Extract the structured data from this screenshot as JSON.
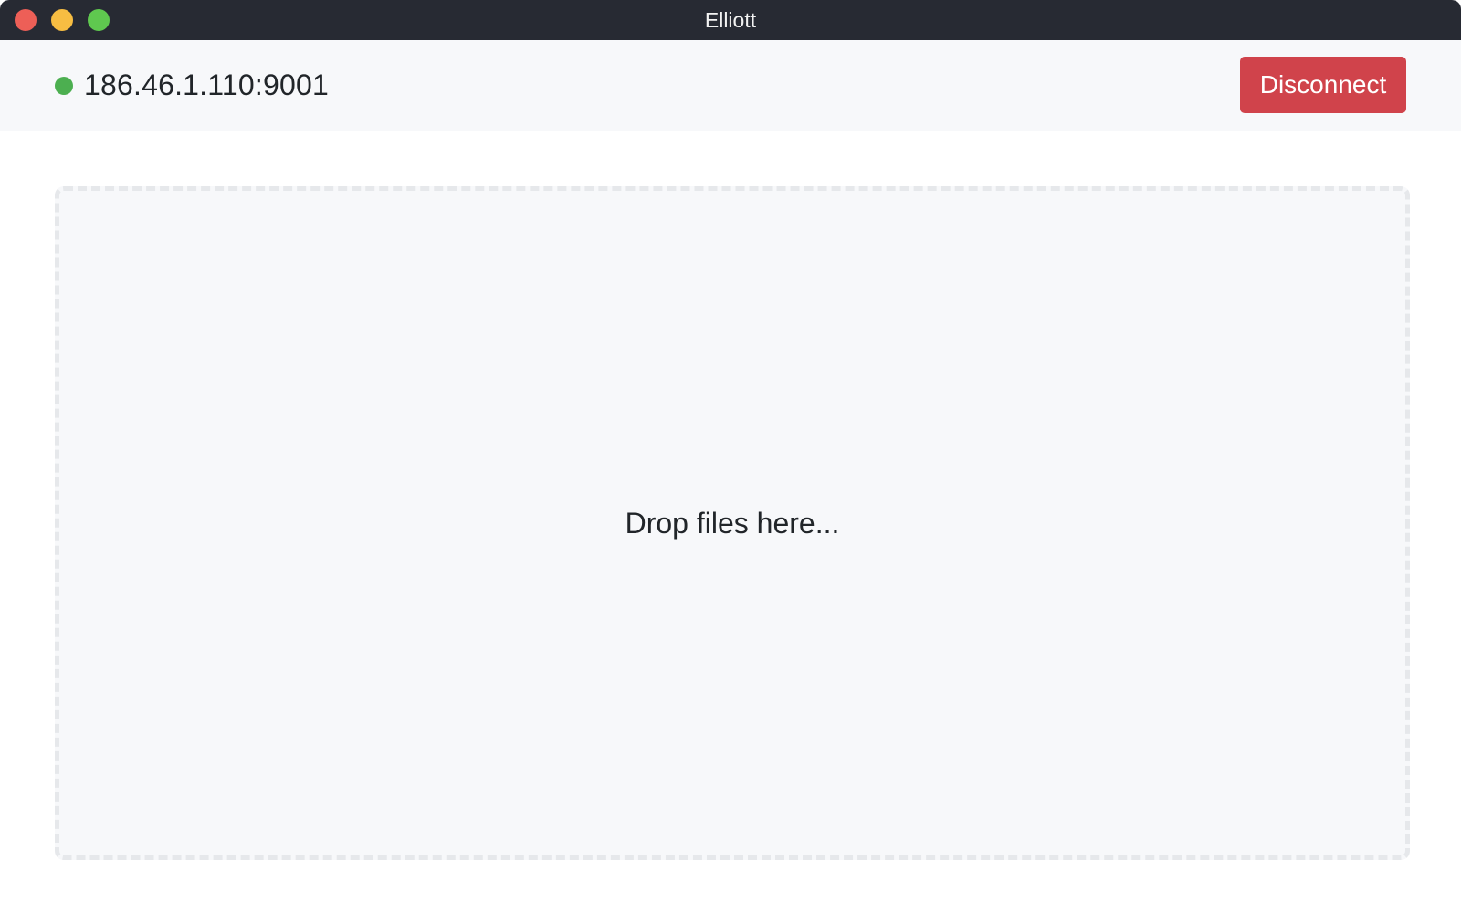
{
  "window": {
    "title": "Elliott",
    "controls": {
      "close_color": "#ed5f57",
      "minimize_color": "#f7bd42",
      "maximize_color": "#5fc84f"
    }
  },
  "connection": {
    "address": "186.46.1.110:9001",
    "status": "connected",
    "status_color": "#4caf50"
  },
  "toolbar": {
    "disconnect_label": "Disconnect",
    "disconnect_color": "#d0434b"
  },
  "dropzone": {
    "prompt": "Drop files here..."
  }
}
